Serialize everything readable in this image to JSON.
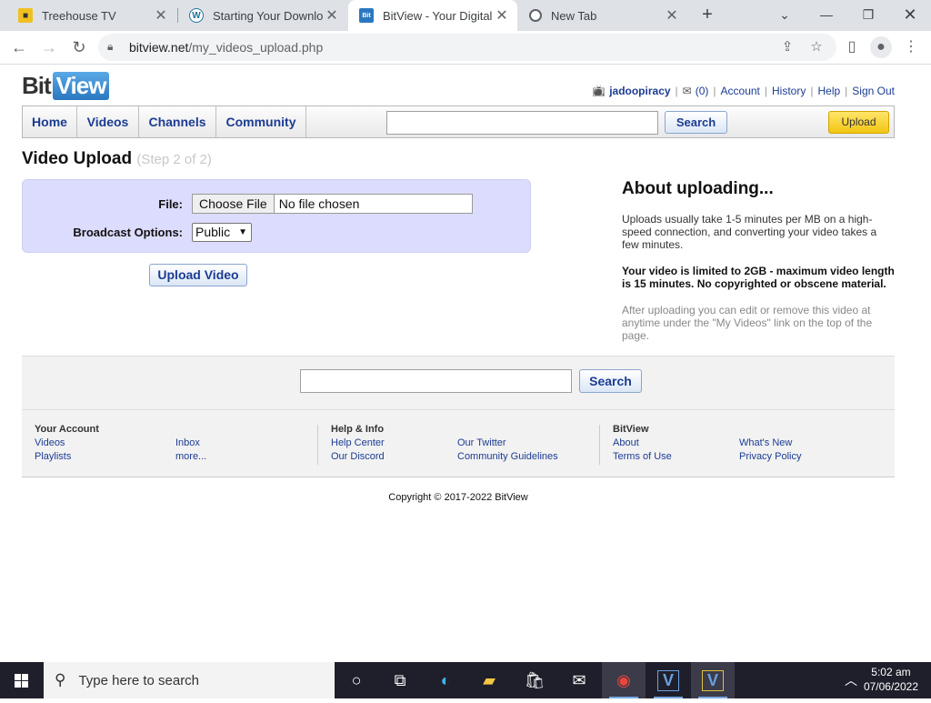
{
  "browser": {
    "tabs": [
      {
        "title": "Treehouse TV",
        "favicon": "treehouse-favicon"
      },
      {
        "title": "Starting Your Download",
        "favicon": "wordpress-favicon"
      },
      {
        "title": "BitView - Your Digital V",
        "favicon": "bitview-favicon",
        "favicon_text": "Bit View"
      },
      {
        "title": "New Tab",
        "favicon": "chrome-favicon"
      }
    ],
    "url_host": "bitview.net",
    "url_path": "/my_videos_upload.php"
  },
  "site": {
    "logo_bit": "Bit",
    "logo_view": "View",
    "user": "jadoopiracy",
    "inbox_count": "(0)",
    "user_links": [
      "Account",
      "History",
      "Help",
      "Sign Out"
    ],
    "nav": [
      "Home",
      "Videos",
      "Channels",
      "Community"
    ],
    "search_label": "Search",
    "upload_label": "Upload"
  },
  "upload": {
    "title": "Video Upload",
    "step": "(Step 2 of 2)",
    "file_label": "File:",
    "choose_file": "Choose File",
    "no_file": "No file chosen",
    "broadcast_label": "Broadcast Options:",
    "broadcast_value": "Public",
    "submit_label": "Upload Video"
  },
  "about": {
    "title": "About uploading...",
    "p1": "Uploads usually take 1-5 minutes per MB on a high-speed connection, and converting your video takes a few minutes.",
    "p2": "Your video is limited to 2GB - maximum video length is 15 minutes. No copyrighted or obscene material.",
    "p3": "After uploading you can edit or remove this video at anytime under the \"My Videos\" link on the top of the page."
  },
  "footer": {
    "search_label": "Search",
    "col1": {
      "heading": "Your Account",
      "links": [
        "Videos",
        "Playlists",
        "Inbox",
        "more..."
      ]
    },
    "col2": {
      "heading": "Help & Info",
      "links": [
        "Help Center",
        "Our Discord",
        "Our Twitter",
        "Community Guidelines"
      ]
    },
    "col3": {
      "heading": "BitView",
      "links": [
        "About",
        "Terms of Use",
        "What's New",
        "Privacy Policy"
      ]
    },
    "copyright": "Copyright © 2017-2022 BitView"
  },
  "taskbar": {
    "search_placeholder": "Type here to search",
    "time": "5:02 am",
    "date": "07/06/2022"
  }
}
